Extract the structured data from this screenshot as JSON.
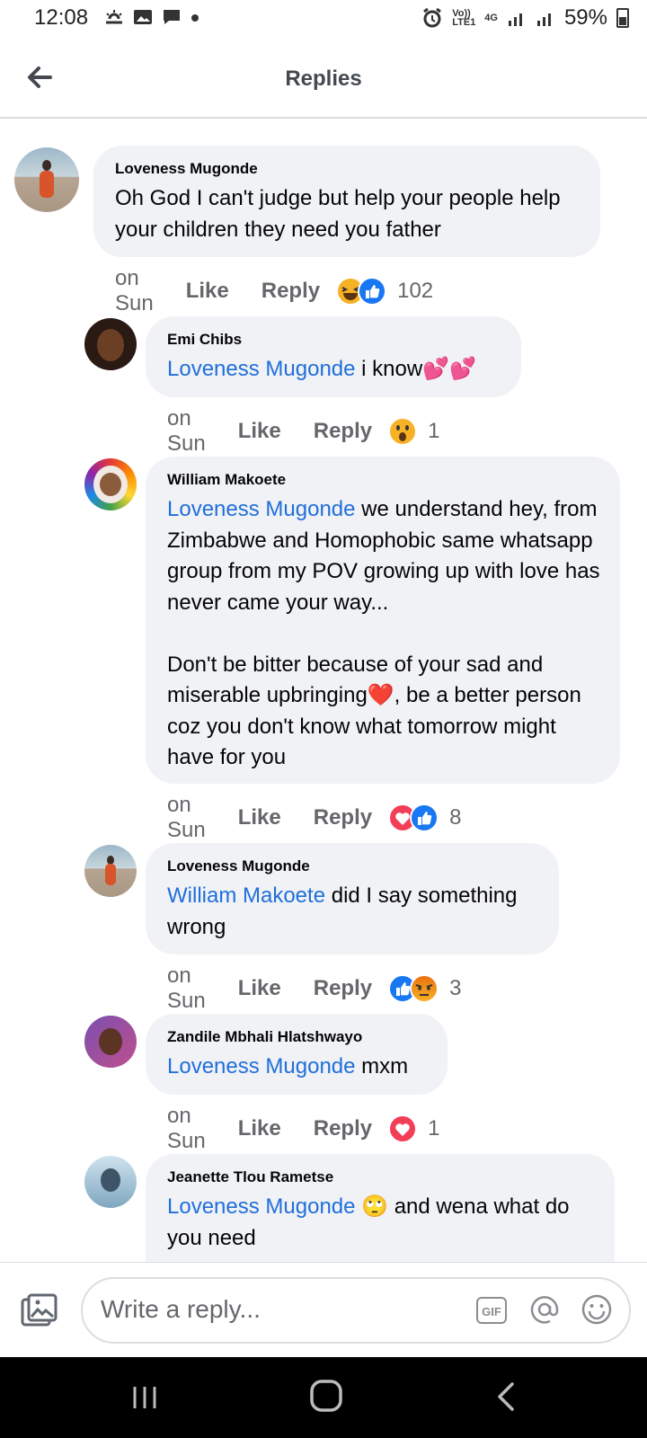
{
  "status_bar": {
    "time": "12:08",
    "volte": "Vo)) LTE1",
    "network": "4G",
    "battery": "59%"
  },
  "header": {
    "title": "Replies"
  },
  "comments": [
    {
      "author": "Loveness Mugonde",
      "mention": "",
      "text": "Oh God I can't judge but help your people help your children they need you father",
      "time": "on Sun",
      "like": "Like",
      "reply": "Reply",
      "reactions": [
        "haha",
        "like"
      ],
      "count": "102"
    },
    {
      "author": "Emi Chibs",
      "mention": "Loveness Mugonde",
      "text": " i know💕💕",
      "time": "on Sun",
      "like": "Like",
      "reply": "Reply",
      "reactions": [
        "wow"
      ],
      "count": "1"
    },
    {
      "author": "William Makoete",
      "mention": "Loveness Mugonde",
      "text": " we understand hey, from Zimbabwe and Homophobic same whatsapp group from my POV growing up with love has never came your way...\n\nDon't be bitter because of your sad and miserable upbringing❤️, be a better person coz you don't know what tomorrow might have for you",
      "time": "on Sun",
      "like": "Like",
      "reply": "Reply",
      "reactions": [
        "love",
        "like"
      ],
      "count": "8"
    },
    {
      "author": "Loveness Mugonde",
      "mention": "William Makoete",
      "text": " did I say something wrong",
      "time": "on Sun",
      "like": "Like",
      "reply": "Reply",
      "reactions": [
        "like",
        "angry"
      ],
      "count": "3"
    },
    {
      "author": "Zandile Mbhali Hlatshwayo",
      "mention": "Loveness Mugonde",
      "text": " mxm",
      "time": "on Sun",
      "like": "Like",
      "reply": "Reply",
      "reactions": [
        "love"
      ],
      "count": "1"
    },
    {
      "author": "Jeanette Tlou Rametse",
      "mention": "Loveness Mugonde",
      "text": " 🙄 and wena what do you need",
      "time": "",
      "like": "",
      "reply": "",
      "reactions": [],
      "count": ""
    }
  ],
  "composer": {
    "placeholder": "Write a reply...",
    "gif_label": "GIF"
  },
  "colors": {
    "mention": "#216fdb",
    "bubble": "#f0f2f5",
    "meta_text": "#65676b",
    "like_blue": "#1877f2",
    "love_red": "#f33e58",
    "haha_yellow": "#f7b125"
  }
}
